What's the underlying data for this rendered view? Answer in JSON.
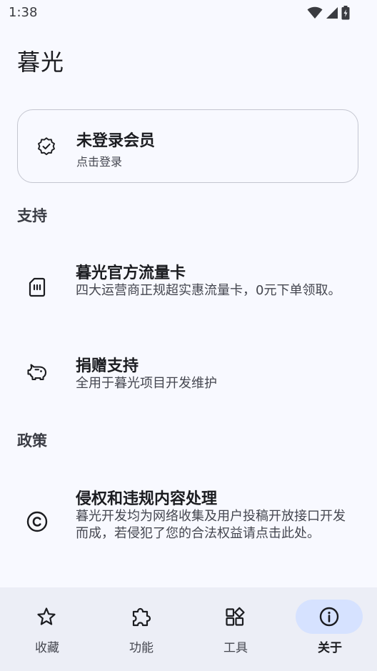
{
  "status_bar": {
    "time": "1:38"
  },
  "page": {
    "title": "暮光"
  },
  "member_card": {
    "title": "未登录会员",
    "subtitle": "点击登录",
    "icon": "verified-badge-icon"
  },
  "sections": {
    "support": {
      "header": "支持",
      "items": [
        {
          "title": "暮光官方流量卡",
          "description": "四大运营商正规超实惠流量卡，0元下单领取。",
          "icon": "sim-card-icon"
        },
        {
          "title": "捐赠支持",
          "description": "全用于暮光项目开发维护",
          "icon": "piggy-bank-icon"
        }
      ]
    },
    "policy": {
      "header": "政策",
      "items": [
        {
          "title": "侵权和违规内容处理",
          "description": "暮光开发均为网络收集及用户投稿开放接口开发而成，若侵犯了您的合法权益请点击此处。",
          "icon": "copyright-icon"
        }
      ]
    }
  },
  "bottom_nav": {
    "items": [
      {
        "label": "收藏",
        "icon": "star-icon",
        "active": false
      },
      {
        "label": "功能",
        "icon": "puzzle-icon",
        "active": false
      },
      {
        "label": "工具",
        "icon": "widgets-icon",
        "active": false
      },
      {
        "label": "关于",
        "icon": "info-icon",
        "active": true
      }
    ]
  },
  "colors": {
    "background": "#f8f9ff",
    "nav_background": "#eceef6",
    "active_indicator": "#d6e2ff",
    "text_primary": "#1b1c20",
    "text_secondary": "#44464f",
    "card_border": "#c4c6d0"
  }
}
